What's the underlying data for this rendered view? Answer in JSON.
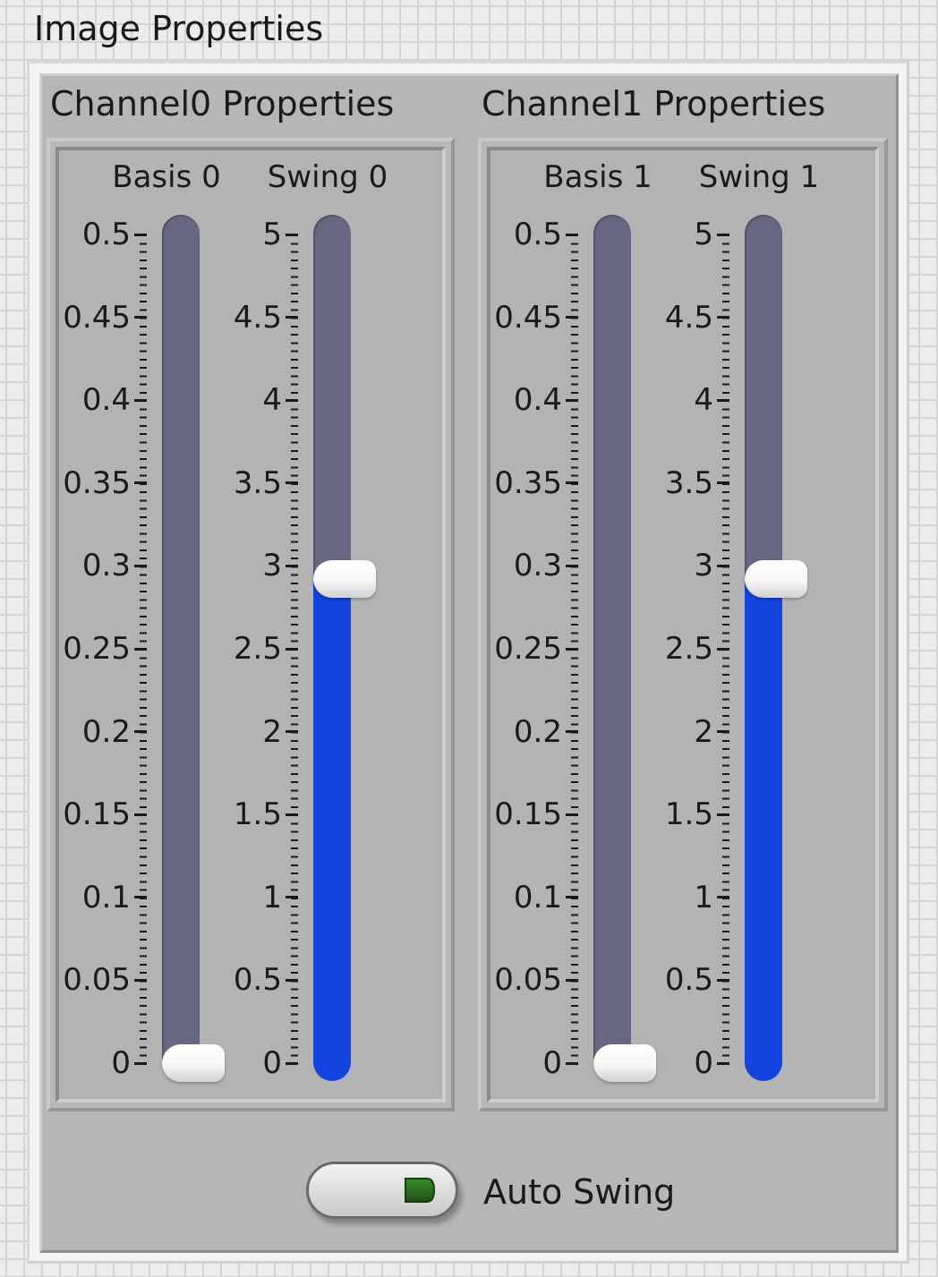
{
  "window": {
    "title": "Image Properties"
  },
  "channels": [
    {
      "title": "Channel0 Properties",
      "sliders": [
        {
          "label": "Basis 0",
          "value": 0,
          "ticks": [
            "0.5",
            "0.45",
            "0.4",
            "0.35",
            "0.3",
            "0.25",
            "0.2",
            "0.15",
            "0.1",
            "0.05",
            "0"
          ]
        },
        {
          "label": "Swing 0",
          "value": 2.92,
          "ticks": [
            "5",
            "4.5",
            "4",
            "3.5",
            "3",
            "2.5",
            "2",
            "1.5",
            "1",
            "0.5",
            "0"
          ]
        }
      ]
    },
    {
      "title": "Channel1 Properties",
      "sliders": [
        {
          "label": "Basis 1",
          "value": 0,
          "ticks": [
            "0.5",
            "0.45",
            "0.4",
            "0.35",
            "0.3",
            "0.25",
            "0.2",
            "0.15",
            "0.1",
            "0.05",
            "0"
          ]
        },
        {
          "label": "Swing 1",
          "value": 2.92,
          "ticks": [
            "5",
            "4.5",
            "4",
            "3.5",
            "3",
            "2.5",
            "2",
            "1.5",
            "1",
            "0.5",
            "0"
          ]
        }
      ]
    }
  ],
  "auto_swing": {
    "label": "Auto Swing",
    "state": "off"
  },
  "colors": {
    "fill": "#1444e0",
    "track": "#676782",
    "led": "#2c6b1f",
    "panel": "#b6b6b6"
  },
  "icons": {
    "toggle_indicator": "play-triangle-led"
  }
}
